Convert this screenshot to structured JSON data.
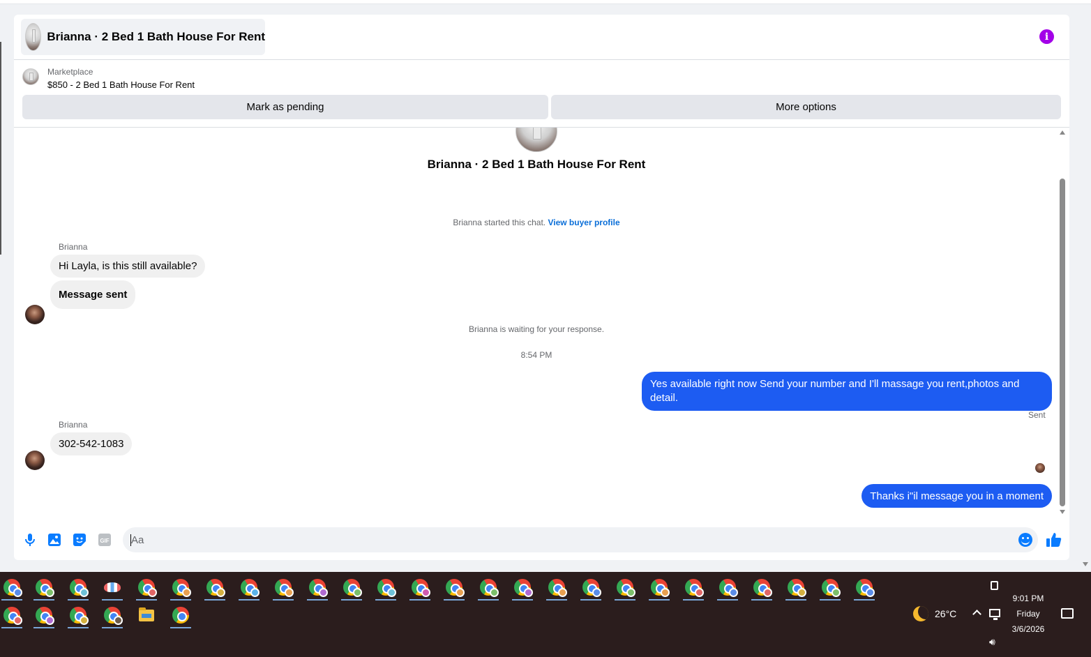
{
  "header": {
    "title": "Brianna · 2 Bed 1 Bath House For Rent"
  },
  "marketplace": {
    "label": "Marketplace",
    "price_title": "$850 - 2 Bed 1 Bath House For Rent",
    "mark_pending": "Mark as pending",
    "more_options": "More options"
  },
  "chat": {
    "title": "Brianna · 2 Bed 1 Bath House For Rent",
    "started_text": "Brianna started this chat.",
    "view_profile": "View buyer profile",
    "sender_name": "Brianna",
    "messages": [
      {
        "text": "Hi Layla, is this still available?"
      },
      {
        "text": "Message sent"
      },
      {
        "text": "Yes available right now Send your number and I'll massage you rent,photos and detail."
      },
      {
        "text": "302-542-1083"
      },
      {
        "text": "Thanks i\"il message you in a moment"
      }
    ],
    "waiting_text": "Brianna is waiting for your response.",
    "timestamp": "8:54 PM",
    "status": "Sent"
  },
  "composer": {
    "placeholder": "Aa"
  },
  "taskbar": {
    "temperature": "26°C",
    "time": "9:01 PM",
    "day": "Friday",
    "date": "3/6/2026"
  },
  "colors": {
    "outgoing_bubble": "#1d5cf2",
    "incoming_bubble": "#f0f0f0",
    "accent": "#0a7cff",
    "info": "#a300e8",
    "taskbar": "#2b1d1d"
  }
}
